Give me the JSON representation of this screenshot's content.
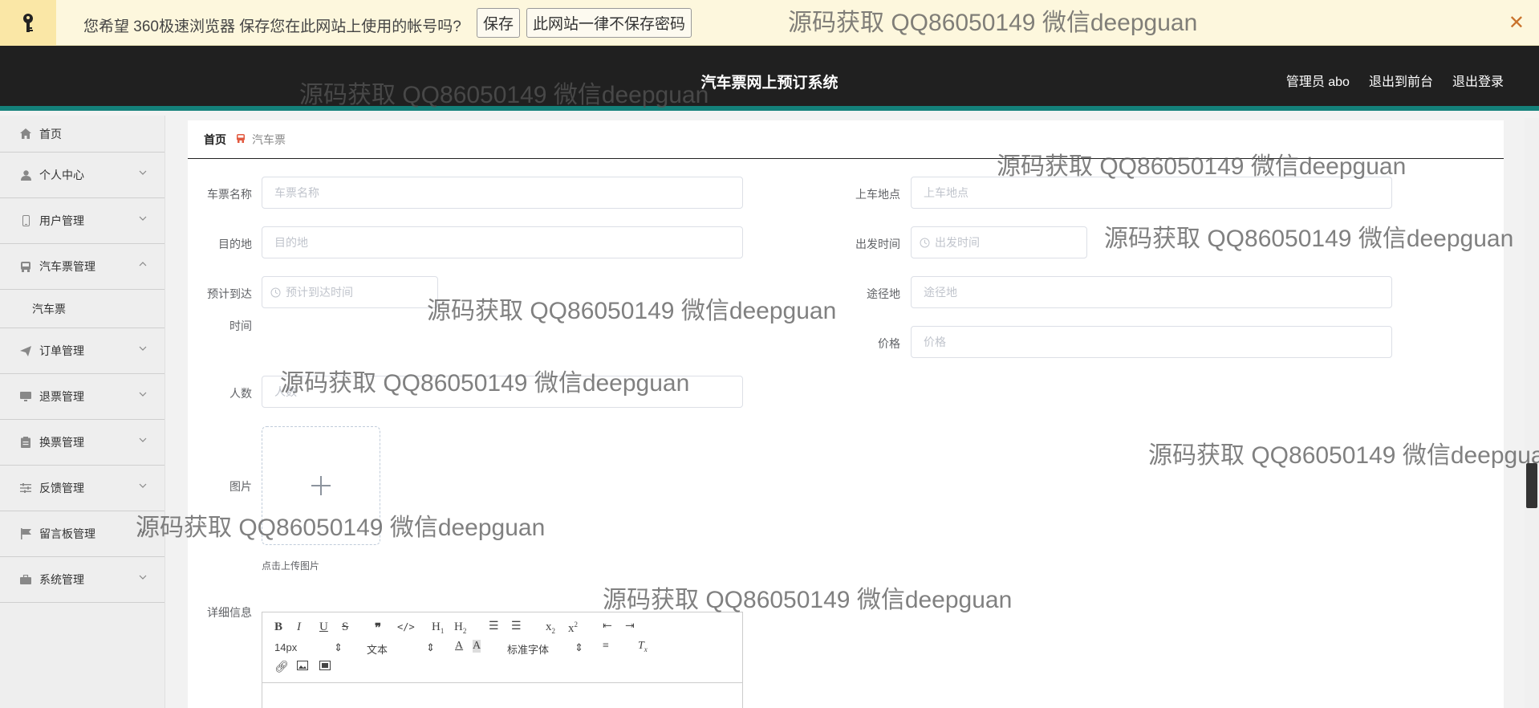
{
  "password_bar": {
    "prompt": "您希望 360极速浏览器 保存您在此网站上使用的帐号吗?",
    "save_label": "保存",
    "never_label": "此网站一律不保存密码",
    "close_glyph": "✕"
  },
  "header": {
    "title": "汽车票网上预订系统",
    "user": "管理员 abo",
    "to_frontend": "退出到前台",
    "logout": "退出登录"
  },
  "sidebar": {
    "items": [
      {
        "label": "首页"
      },
      {
        "label": "个人中心"
      },
      {
        "label": "用户管理"
      },
      {
        "label": "汽车票管理"
      },
      {
        "label": "汽车票"
      },
      {
        "label": "订单管理"
      },
      {
        "label": "退票管理"
      },
      {
        "label": "换票管理"
      },
      {
        "label": "反馈管理"
      },
      {
        "label": "留言板管理"
      },
      {
        "label": "系统管理"
      }
    ]
  },
  "breadcrumb": {
    "home": "首页",
    "current": "汽车票"
  },
  "form": {
    "ticket_name": {
      "label": "车票名称",
      "placeholder": "车票名称"
    },
    "boarding": {
      "label": "上车地点",
      "placeholder": "上车地点"
    },
    "destination": {
      "label": "目的地",
      "placeholder": "目的地"
    },
    "departure_time": {
      "label": "出发时间",
      "placeholder": "出发时间"
    },
    "arrival_label_1": "预计到达",
    "arrival_label_2": "时间",
    "arrival_placeholder": "预计到达时间",
    "via": {
      "label": "途径地",
      "placeholder": "途径地"
    },
    "price": {
      "label": "价格",
      "placeholder": "价格"
    },
    "count": {
      "label": "人数",
      "placeholder": "人数"
    },
    "image": {
      "label": "图片",
      "tip": "点击上传图片"
    },
    "detail": {
      "label": "详细信息"
    }
  },
  "editor": {
    "font_size": "14px",
    "text_type": "文本",
    "font_family": "标准字体"
  },
  "watermark_text": "源码获取 QQ86050149 微信deepguan",
  "colors": {
    "header_bg": "#202020",
    "accent": "#14817a",
    "breadcrumb_sep": "#e2583e"
  }
}
